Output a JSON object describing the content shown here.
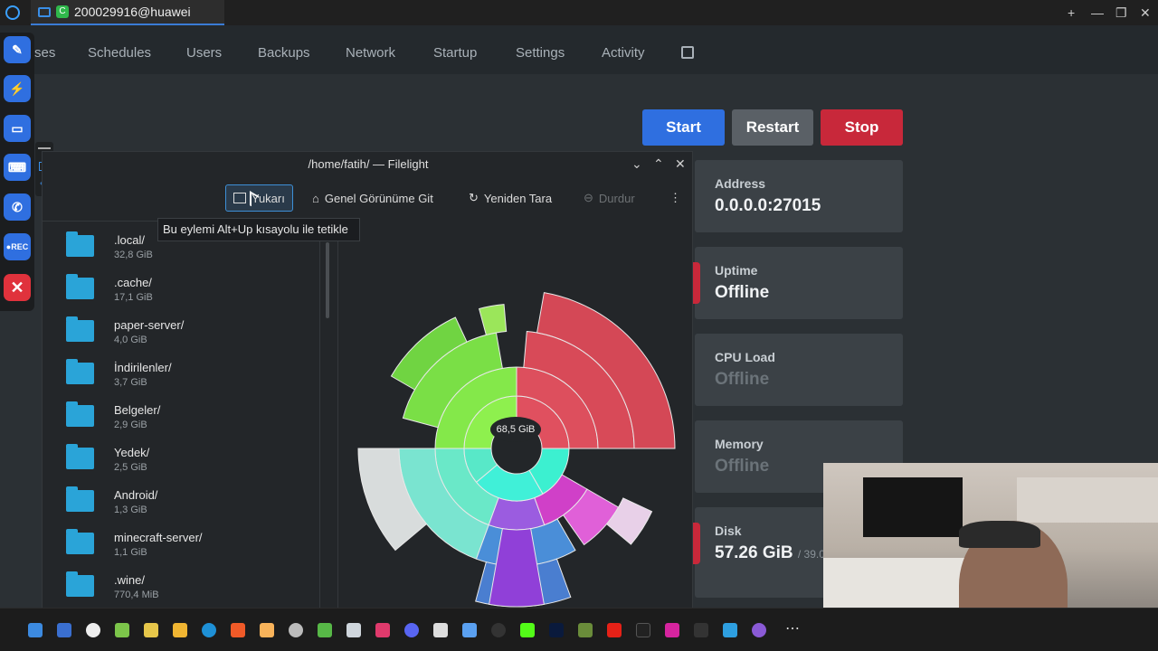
{
  "window": {
    "tab_title": "200029916@huawei",
    "controls": [
      "+",
      "—",
      "❐",
      "✕"
    ]
  },
  "nav": {
    "items": [
      "ses",
      "Schedules",
      "Users",
      "Backups",
      "Network",
      "Startup",
      "Settings",
      "Activity"
    ]
  },
  "actions": {
    "start": "Start",
    "restart": "Restart",
    "stop": "Stop"
  },
  "cards": {
    "address": {
      "label": "Address",
      "value": "0.0.0.0:27015"
    },
    "uptime": {
      "label": "Uptime",
      "value": "Offline"
    },
    "cpu": {
      "label": "CPU Load",
      "value": "Offline"
    },
    "memory": {
      "label": "Memory",
      "value": "Offline"
    },
    "disk": {
      "label": "Disk",
      "value": "57.26 GiB",
      "suffix": "/ 39.0"
    }
  },
  "dock": {
    "rec_label": "●REC"
  },
  "filelight": {
    "title": "/home/fatih/ — Filelight",
    "toolbar": {
      "up": "Yukarı",
      "overview": "Genel Görünüme Git",
      "rescan": "Yeniden Tara",
      "stop": "Durdur"
    },
    "tooltip": "Bu eylemi Alt+Up kısayolu ile tetikle",
    "center_label": "68,5 GiB",
    "folders": [
      {
        "name": ".local/",
        "size": "32,8 GiB"
      },
      {
        "name": ".cache/",
        "size": "17,1 GiB"
      },
      {
        "name": "paper-server/",
        "size": "4,0 GiB"
      },
      {
        "name": "İndirilenler/",
        "size": "3,7 GiB"
      },
      {
        "name": "Belgeler/",
        "size": "2,9 GiB"
      },
      {
        "name": "Yedek/",
        "size": "2,5 GiB"
      },
      {
        "name": "Android/",
        "size": "1,3 GiB"
      },
      {
        "name": "minecraft-server/",
        "size": "1,1 GiB"
      },
      {
        "name": ".wine/",
        "size": "770,4 MiB"
      }
    ]
  },
  "colors": {
    "start": "#2f6fe0",
    "restart": "#5a6066",
    "stop": "#c8283a",
    "accent": "#3d8fd6"
  }
}
